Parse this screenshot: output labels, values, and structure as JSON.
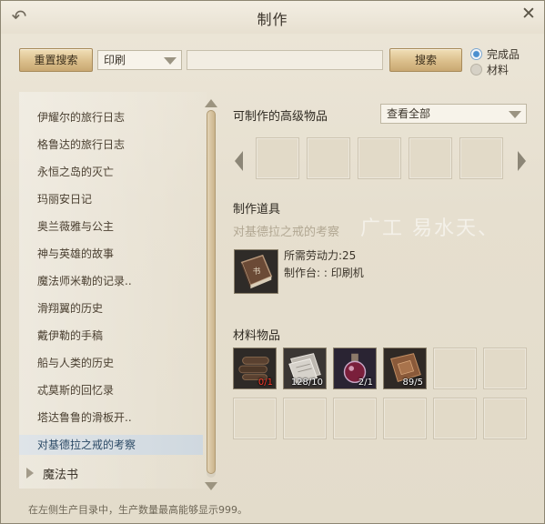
{
  "window": {
    "title": "制作"
  },
  "toolbar": {
    "reset_search_label": "重置搜索",
    "category_select_value": "印刷",
    "search_input_value": "",
    "search_button_label": "搜索"
  },
  "filter": {
    "options": [
      {
        "label": "完成品",
        "selected": true
      },
      {
        "label": "材料",
        "selected": false
      }
    ]
  },
  "recipe_list": {
    "items": [
      "伊耀尔的旅行日志",
      "格鲁达的旅行日志",
      "永恒之岛的灭亡",
      "玛丽安日记",
      "奥兰薇雅与公主",
      "神与英雄的故事",
      "魔法师米勒的记录..",
      "滑翔翼的历史",
      "戴伊勒的手稿",
      "船与人类的历史",
      "忒莫斯的回忆录",
      "塔达鲁鲁的滑板开..",
      "对基德拉之戒的考察"
    ],
    "selected_index": 12,
    "category": "魔法书"
  },
  "advanced_items": {
    "heading": "可制作的高级物品",
    "view_select_value": "查看全部"
  },
  "craft_tool": {
    "heading": "制作道具",
    "item_name": "对基德拉之戒的考察",
    "labor_line": "所需劳动力:25",
    "station_line": "制作台: : 印刷机"
  },
  "materials": {
    "heading": "材料物品",
    "items": [
      {
        "icon": "scroll-bundle-icon",
        "count": "0/1",
        "insufficient": true
      },
      {
        "icon": "paper-sheets-icon",
        "count": "128/10",
        "insufficient": false
      },
      {
        "icon": "ink-flask-icon",
        "count": "2/1",
        "insufficient": false
      },
      {
        "icon": "leather-cover-icon",
        "count": "89/5",
        "insufficient": false
      }
    ]
  },
  "footer": {
    "note": "在左侧生产目录中，生产数量最高能够显示999。"
  },
  "watermark_text": "广工  易水天、",
  "colors": {
    "accent_button": "#dbbf8c",
    "selected_row": "#cfd8df",
    "insufficient_count": "#ff3a2a"
  }
}
